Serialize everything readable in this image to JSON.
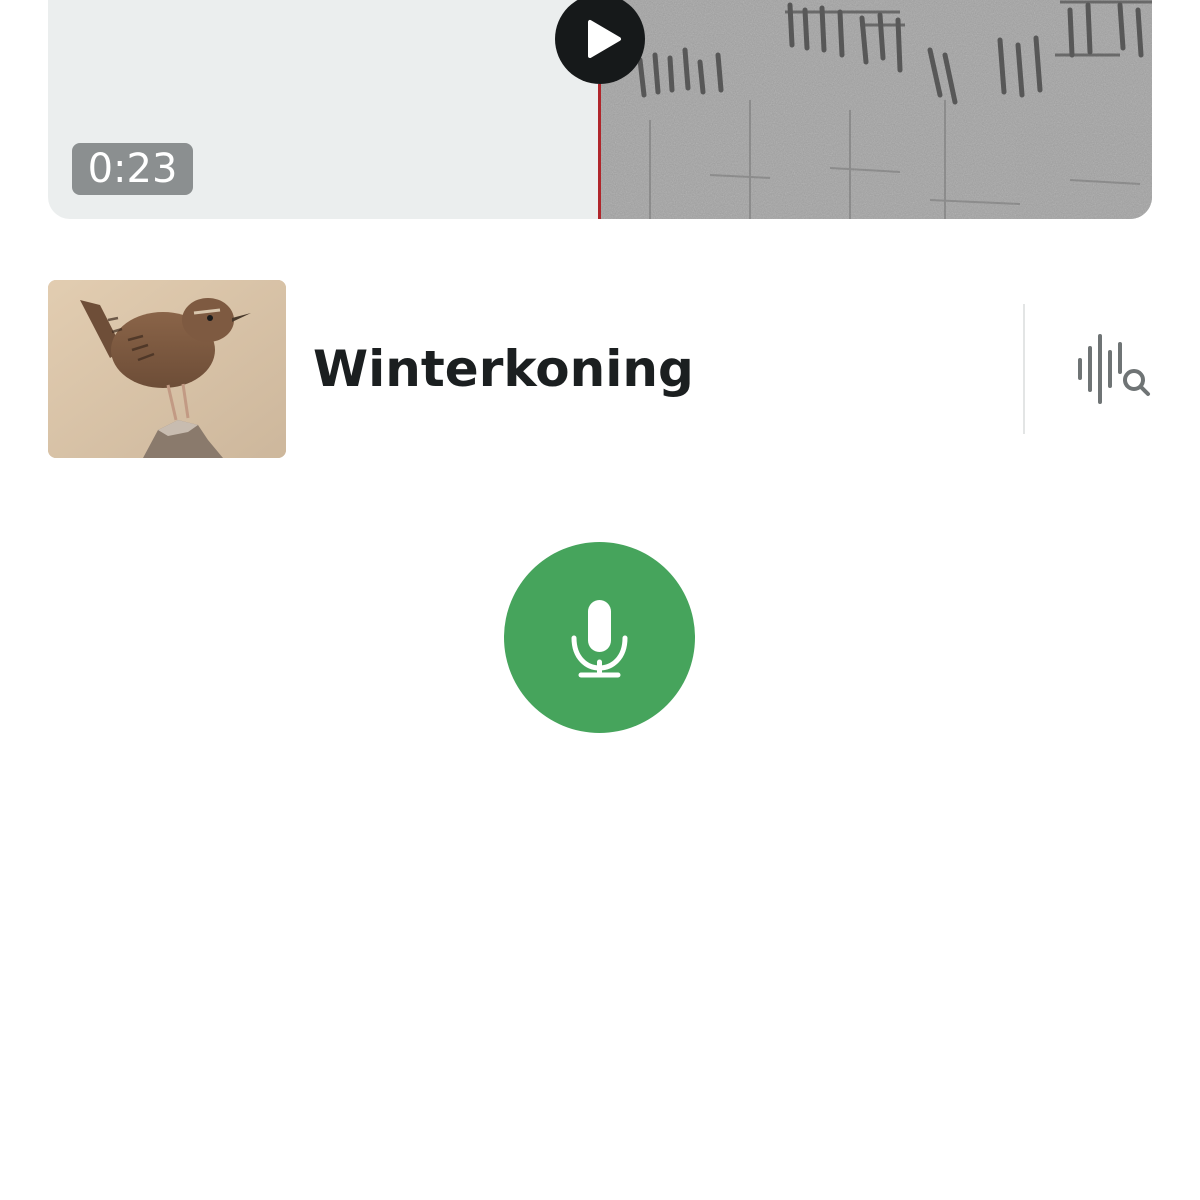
{
  "player": {
    "elapsed_time": "0:23",
    "play_icon": "play-icon",
    "playhead_color": "#b0262b",
    "background_color": "#ebeeee"
  },
  "species": {
    "name": "Winterkoning",
    "thumbnail_icon": "bird-photo",
    "sound_search_icon": "sound-search-icon"
  },
  "record": {
    "icon": "microphone-icon",
    "color": "#46a45c"
  }
}
